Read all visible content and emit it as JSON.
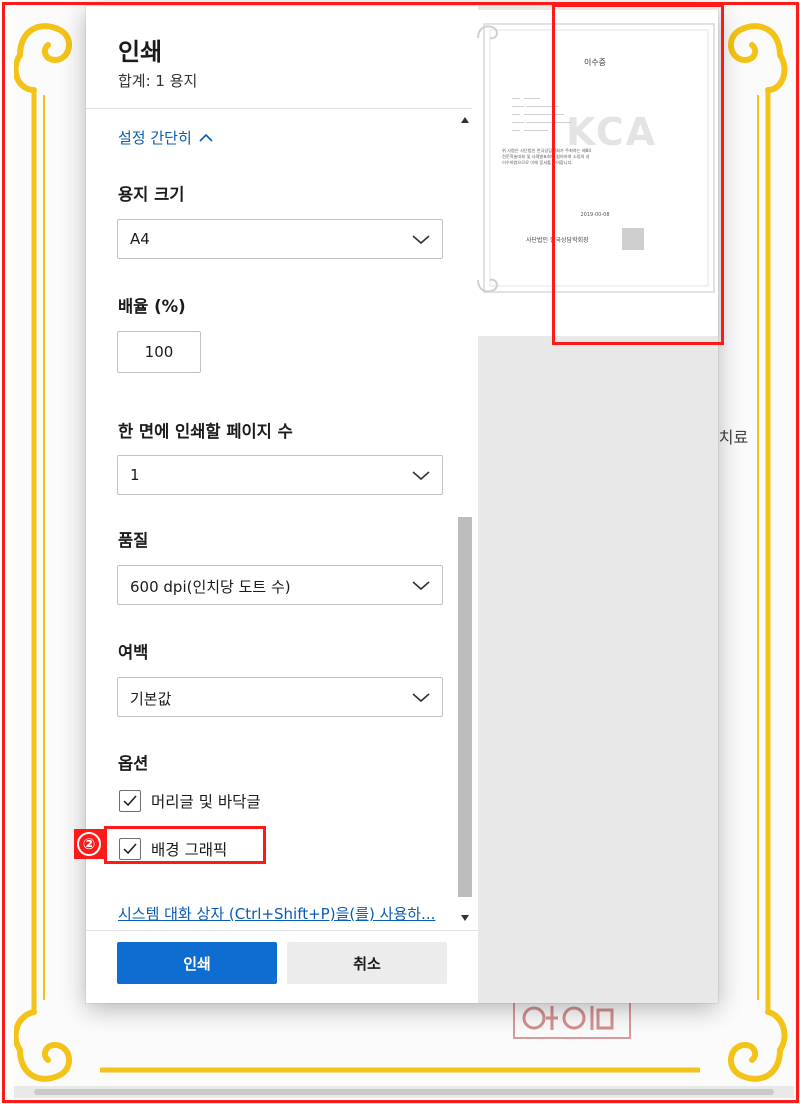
{
  "dialog": {
    "title": "인쇄",
    "subtitle": "합계: 1 용지",
    "collapse_label": "설정 간단히",
    "paper_size": {
      "label": "용지 크기",
      "value": "A4"
    },
    "scale": {
      "label": "배율 (%)",
      "value": "100"
    },
    "pages_per_sheet": {
      "label": "한 면에 인쇄할 페이지 수",
      "value": "1"
    },
    "quality": {
      "label": "품질",
      "value": "600 dpi(인치당 도트 수)"
    },
    "margins": {
      "label": "여백",
      "value": "기본값"
    },
    "options": {
      "label": "옵션",
      "items": [
        {
          "label": "머리글 및 바닥글",
          "checked": true
        },
        {
          "label": "배경 그래픽",
          "checked": true
        }
      ]
    },
    "system_dialog_link": "시스템 대화 상자 (Ctrl+Shift+P)을(를) 사용하...",
    "print_button": "인쇄",
    "cancel_button": "취소"
  },
  "preview": {
    "doc_title": "이수증",
    "date": "2019-00-08",
    "organization": "사단법인 한국상담학회장",
    "logo_text": "KCA",
    "body_lines": [
      "위 사람은 사단법인 한국상담학회가 주최하는 제84",
      "전문학술대회 및 사례발표회에 참여하여 소정의 과",
      "이수하였으므로 이에 증서를 수여합니다."
    ]
  },
  "background": {
    "side_text": "리치료"
  },
  "annotations": {
    "step_marker": "②"
  },
  "colors": {
    "accent": "#0f6cd0",
    "link": "#0a5bb5",
    "annotation": "#ff1a1a",
    "frame_gold": "#f3c318"
  }
}
